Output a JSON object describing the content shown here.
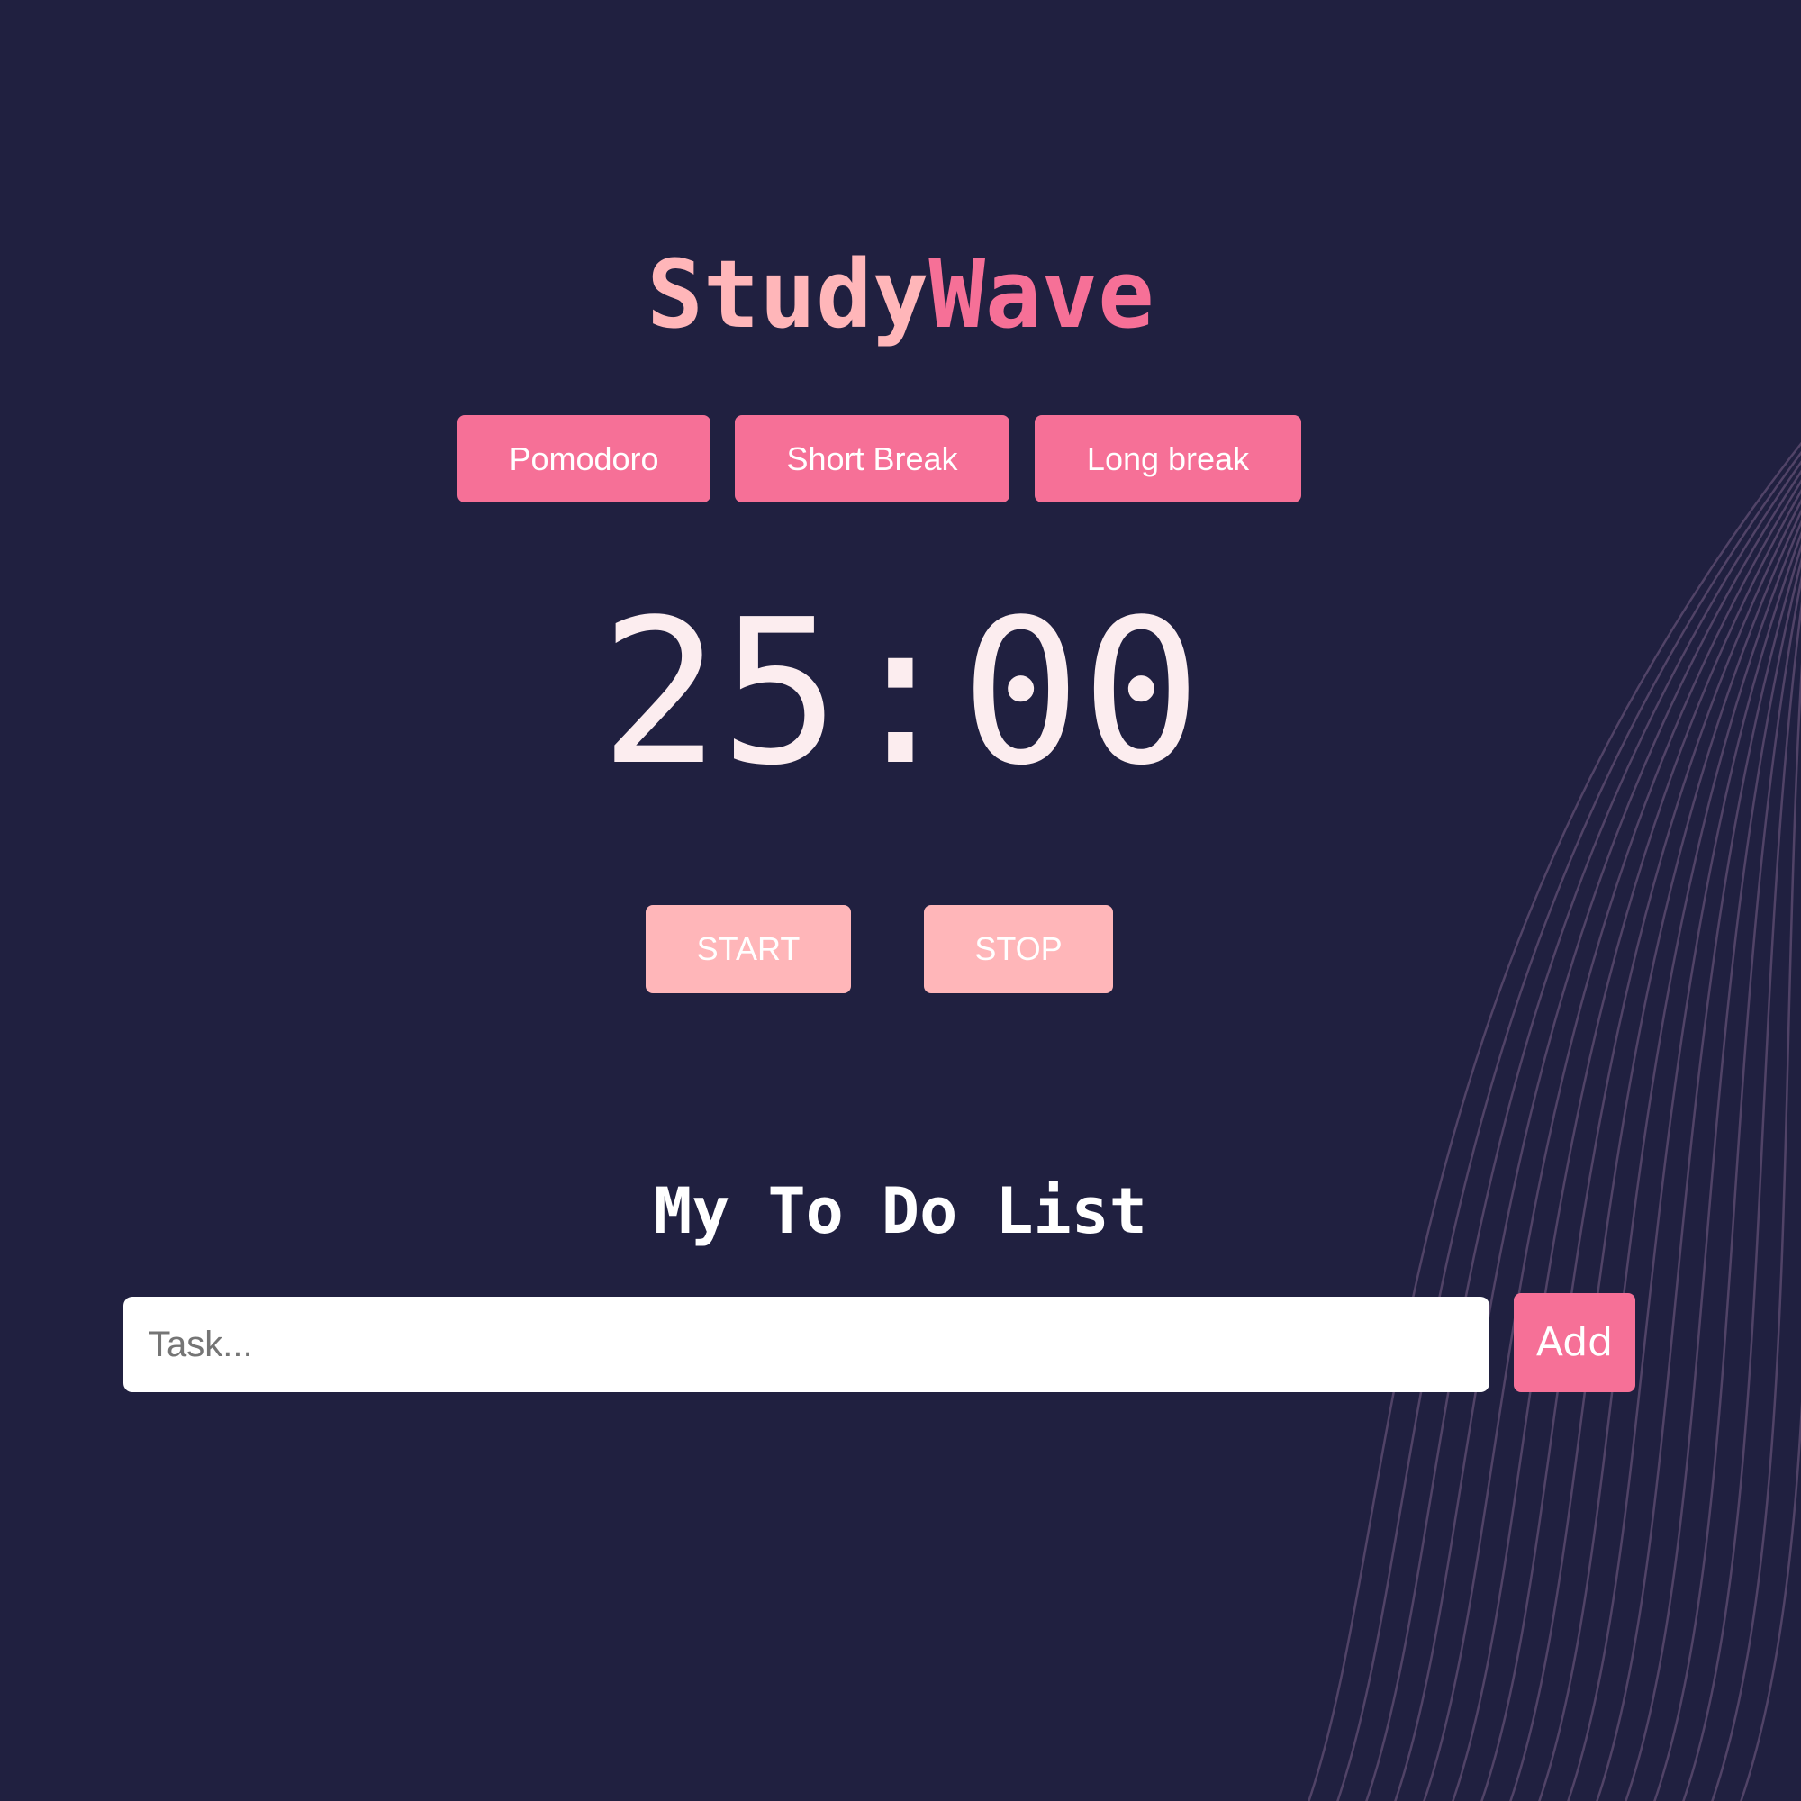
{
  "app": {
    "title_part1": "Study",
    "title_part2": "Wave"
  },
  "modes": {
    "pomodoro": "Pomodoro",
    "short_break": "Short Break",
    "long_break": "Long break"
  },
  "timer": {
    "display": "25:00"
  },
  "controls": {
    "start": "START",
    "stop": "STOP"
  },
  "todo": {
    "heading": "My To Do List",
    "input_value": "",
    "input_placeholder": "Task...",
    "add_label": "Add"
  },
  "colors": {
    "background": "#202040",
    "accent": "#f67097",
    "accent_light": "#ffb6b9",
    "timer_text": "#fcedef",
    "wave_lines": "#5a4a6e"
  }
}
